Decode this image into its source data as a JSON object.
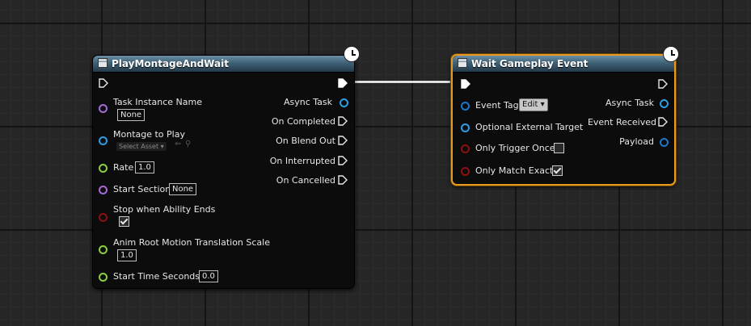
{
  "node_montage": {
    "title": "PlayMontageAndWait",
    "inputs": {
      "task_instance_name": {
        "label": "Task Instance Name",
        "value": "None"
      },
      "montage_to_play": {
        "label": "Montage to Play",
        "value": "Select Asset"
      },
      "rate": {
        "label": "Rate",
        "value": "1.0"
      },
      "start_section": {
        "label": "Start Section",
        "value": "None"
      },
      "stop_when_ability_ends": {
        "label": "Stop when Ability Ends",
        "checked": true
      },
      "anim_root_motion": {
        "label": "Anim Root Motion Translation Scale",
        "value": "1.0"
      },
      "start_time_seconds": {
        "label": "Start Time Seconds",
        "value": "0.0"
      }
    },
    "outputs": {
      "async_task": "Async Task",
      "on_completed": "On Completed",
      "on_blend_out": "On Blend Out",
      "on_interrupted": "On Interrupted",
      "on_cancelled": "On Cancelled"
    }
  },
  "node_wait_event": {
    "title": "Wait Gameplay Event",
    "inputs": {
      "event_tag": {
        "label": "Event Tag",
        "button": "Edit"
      },
      "optional_external_target": {
        "label": "Optional External Target"
      },
      "only_trigger_once": {
        "label": "Only Trigger Once",
        "checked": false
      },
      "only_match_exact": {
        "label": "Only Match Exact",
        "checked": true
      }
    },
    "outputs": {
      "async_task": "Async Task",
      "event_received": "Event Received",
      "payload": "Payload"
    }
  },
  "colors": {
    "selected_outline": "#e89a1e",
    "object_pin": "#2a9ee6",
    "name_pin": "#a868d8",
    "float_pin": "#8ccf3c",
    "bool_pin": "#8c1010"
  }
}
